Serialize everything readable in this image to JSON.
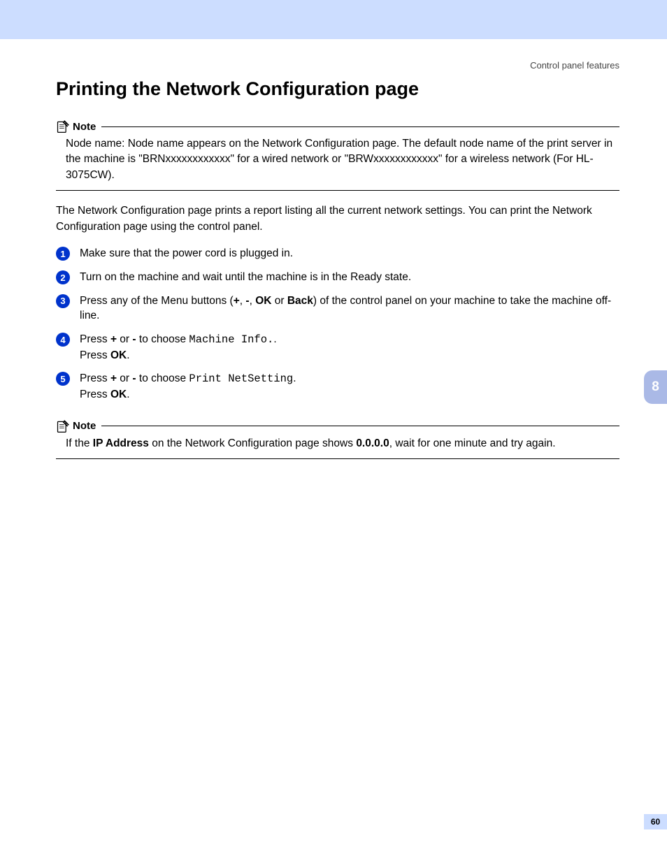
{
  "header": {
    "breadcrumb": "Control panel features"
  },
  "title": "Printing the Network Configuration page",
  "note1": {
    "label": "Note",
    "body_html": "Node name: Node name appears on the Network Configuration page. The default node name of the print server in the machine is \"BRNxxxxxxxxxxxx\" for a wired network or \"BRWxxxxxxxxxxxx\" for a wireless network (For HL-3075CW)."
  },
  "intro": "The Network Configuration page prints a report listing all the current network settings. You can print the Network Configuration page using the control panel.",
  "steps": [
    {
      "n": "1",
      "html": "Make sure that the power cord is plugged in."
    },
    {
      "n": "2",
      "html": "Turn on the machine and wait until the machine is in the Ready state."
    },
    {
      "n": "3",
      "html": "Press any of the Menu buttons (<b>+</b>, <b>-</b>, <b>OK</b> or <b>Back</b>) of the control panel on your machine to take the machine off-line."
    },
    {
      "n": "4",
      "html": "Press <b>+</b> or <b>-</b> to choose <span class=\"mono\">Machine Info.</span>.<br>Press <b>OK</b>."
    },
    {
      "n": "5",
      "html": "Press <b>+</b> or <b>-</b> to choose <span class=\"mono\">Print NetSetting</span>.<br>Press <b>OK</b>."
    }
  ],
  "note2": {
    "label": "Note",
    "body_html": "If the <b>IP Address</b> on the Network Configuration page shows <b>0.0.0.0</b>, wait for one minute and try again."
  },
  "side_tab": "8",
  "page_number": "60"
}
